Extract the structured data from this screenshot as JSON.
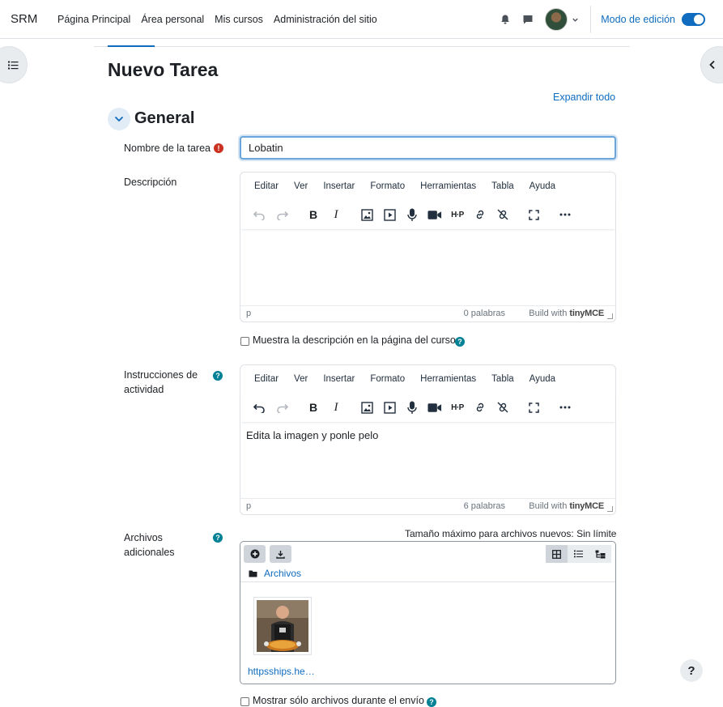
{
  "navbar": {
    "brand": "SRM",
    "links": [
      "Página Principal",
      "Área personal",
      "Mis cursos",
      "Administración del sitio"
    ],
    "edit_mode_label": "Modo de edición",
    "edit_mode_on": true
  },
  "page": {
    "title": "Nuevo Tarea",
    "expand_all": "Expandir todo",
    "section_title": "General"
  },
  "form": {
    "name_label": "Nombre de la tarea",
    "name_value": "Lobatin",
    "description_label": "Descripción",
    "show_description_label": "Muestra la descripción en la página del curso",
    "instructions_label_1": "Instrucciones de",
    "instructions_label_2": "actividad",
    "files_label_1": "Archivos",
    "files_label_2": "adicionales",
    "files_only_label": "Mostrar sólo archivos durante el envío"
  },
  "editor": {
    "menu": [
      "Editar",
      "Ver",
      "Insertar",
      "Formato",
      "Herramientas",
      "Tabla",
      "Ayuda"
    ],
    "built_with": "Build with",
    "brand": "tinyMCE"
  },
  "description_editor": {
    "content": "",
    "path": "p",
    "word_count": "0 palabras"
  },
  "instructions_editor": {
    "content": "Edita la imagen y ponle pelo",
    "path": "p",
    "word_count": "6 palabras"
  },
  "filemanager": {
    "max_size": "Tamaño máximo para archivos nuevos: Sin límite",
    "folder": "Archivos",
    "file_name": "httpsships.he…"
  },
  "help_button": "?",
  "colors": {
    "accent": "#0f6cbf",
    "required": "#ca3120",
    "help": "#008196"
  }
}
